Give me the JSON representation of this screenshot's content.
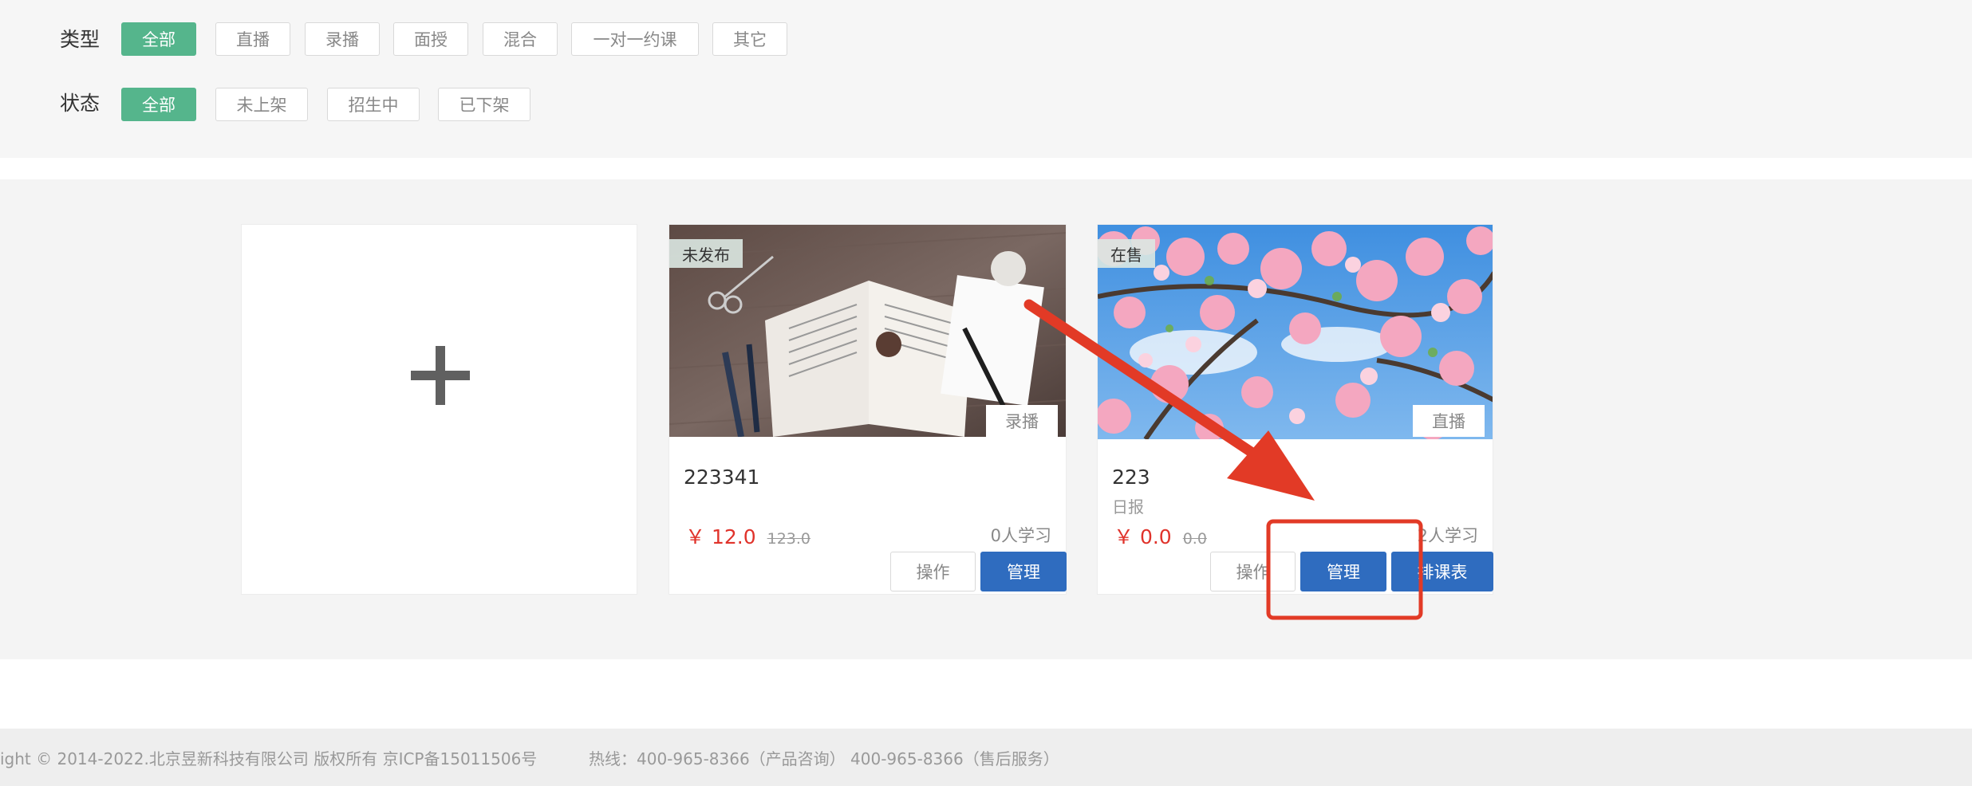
{
  "filters": {
    "type": {
      "label": "类型",
      "options": [
        "全部",
        "直播",
        "录播",
        "面授",
        "混合",
        "一对一约课",
        "其它"
      ],
      "selected": "全部"
    },
    "status": {
      "label": "状态",
      "options": [
        "全部",
        "未上架",
        "招生中",
        "已下架"
      ],
      "selected": "全部"
    }
  },
  "add_card": {
    "icon": "plus-icon"
  },
  "courses": [
    {
      "status": "未发布",
      "type": "录播",
      "title": "223341",
      "subtitle": "",
      "price": "￥ 12.0",
      "original_price": "123.0",
      "learners": "0人学习",
      "buttons": [
        "操作",
        "管理"
      ]
    },
    {
      "status": "在售",
      "type": "直播",
      "title": "223",
      "subtitle": "日报",
      "price": "￥ 0.0",
      "original_price": "0.0",
      "learners": "2人学习",
      "buttons": [
        "操作",
        "管理",
        "排课表"
      ]
    }
  ],
  "footer": {
    "copyright": "ight © 2014-2022.北京昱新科技有限公司 版权所有 京ICP备15011506号",
    "hotline": "热线：400-965-8366（产品咨询） 400-965-8366（售后服务）"
  },
  "colors": {
    "accent_green": "#55b58c",
    "primary_blue": "#2f6cbf",
    "price_red": "#e0332b",
    "annotation_red": "#e23a26"
  }
}
